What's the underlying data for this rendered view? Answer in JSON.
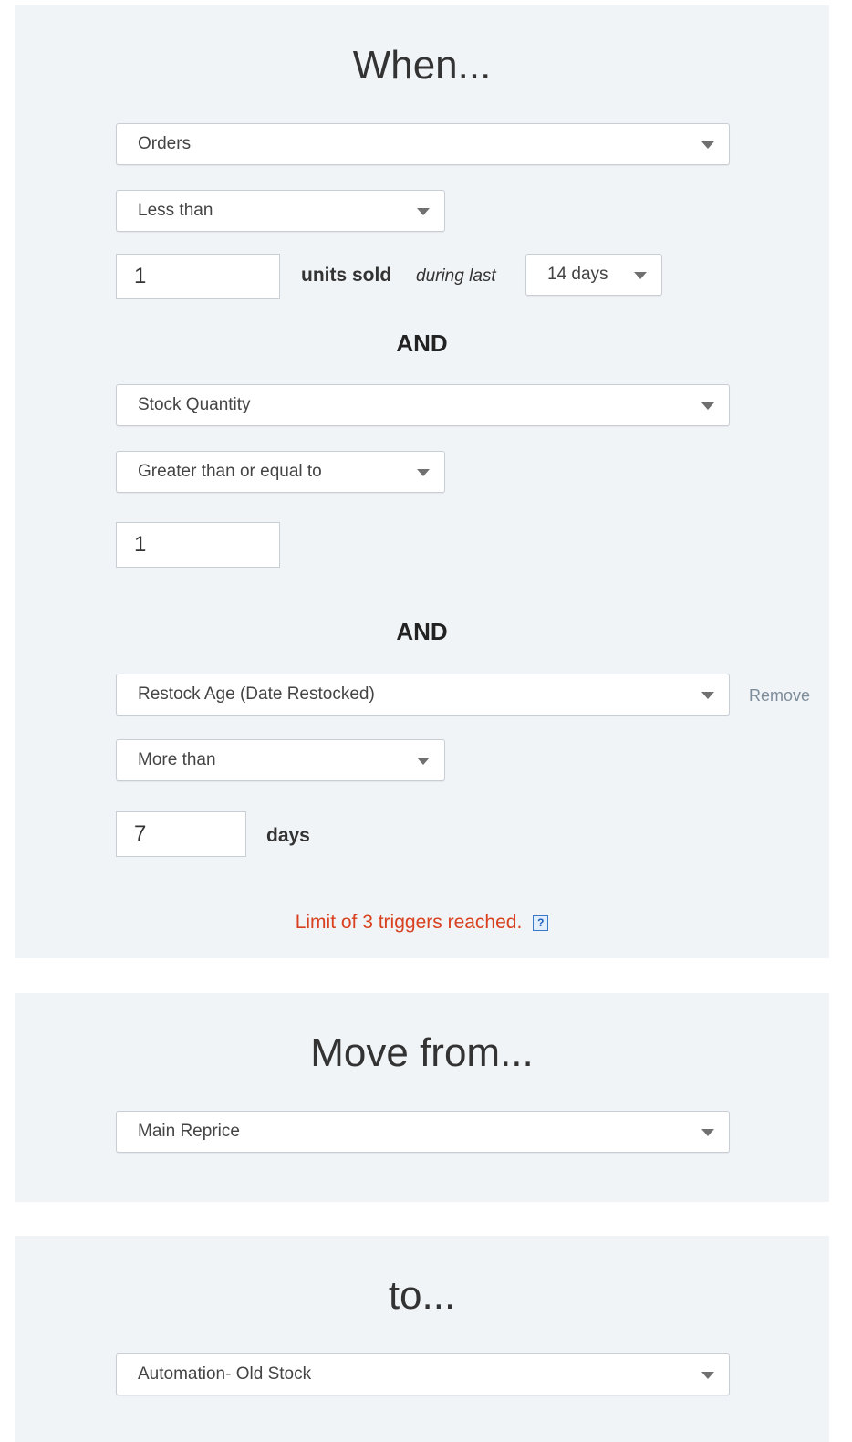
{
  "when_section": {
    "title": "When...",
    "trigger1": {
      "field": "Orders",
      "operator": "Less than",
      "value": "1",
      "unit_label": "units sold",
      "period_label": "during last",
      "period": "14 days"
    },
    "and1": "AND",
    "trigger2": {
      "field": "Stock Quantity",
      "operator": "Greater than or equal to",
      "value": "1"
    },
    "and2": "AND",
    "trigger3": {
      "field": "Restock Age (Date Restocked)",
      "remove_label": "Remove",
      "operator": "More than",
      "value": "7",
      "unit_label": "days"
    },
    "limit_message": "Limit of 3 triggers reached.",
    "help_icon": "?"
  },
  "move_from_section": {
    "title": "Move from...",
    "selected": "Main Reprice"
  },
  "to_section": {
    "title": "to...",
    "selected": "Automation- Old Stock"
  },
  "colors": {
    "panel_bg": "#f1f4f7",
    "error_text": "#d8401f",
    "remove_link": "#7d8c99"
  }
}
